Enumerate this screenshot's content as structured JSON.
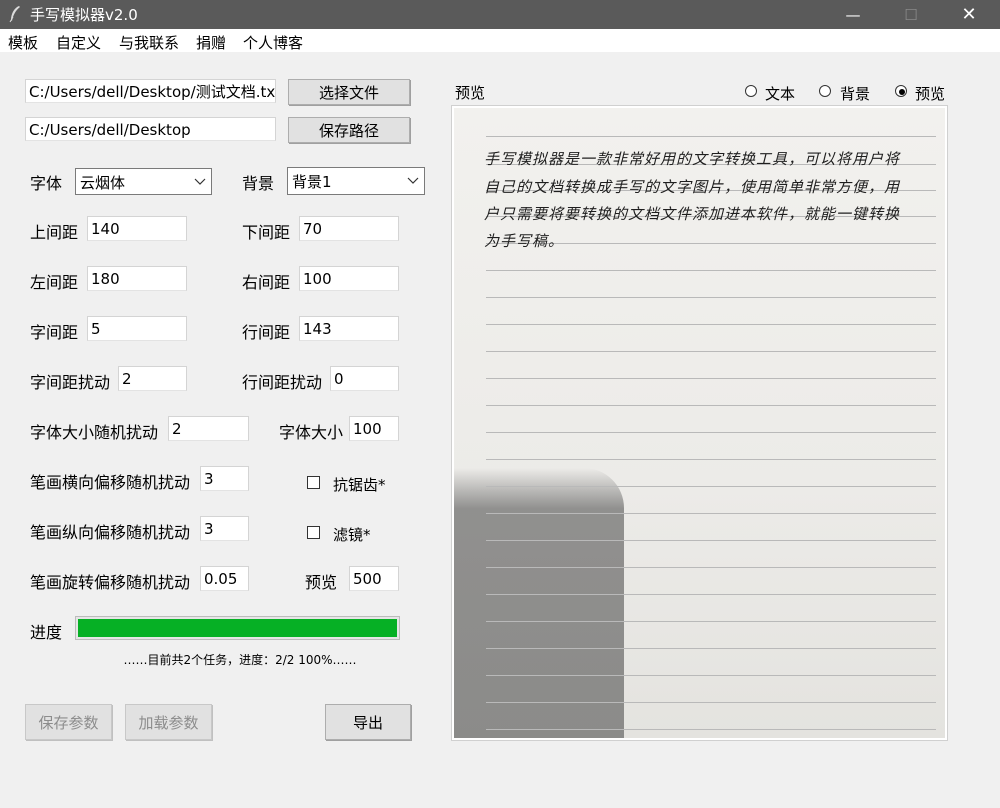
{
  "window": {
    "title": "手写模拟器v2.0",
    "controls": {
      "minimize": "—",
      "maximize": "☐",
      "close": "✕"
    }
  },
  "menu": [
    "模板",
    "自定义",
    "与我联系",
    "捐赠",
    "个人博客"
  ],
  "files": {
    "input_path": "C:/Users/dell/Desktop/测试文档.txt",
    "select_file_label": "选择文件",
    "output_path": "C:/Users/dell/Desktop",
    "save_path_label": "保存路径"
  },
  "font": {
    "label": "字体",
    "value": "云烟体"
  },
  "background": {
    "label": "背景",
    "value": "背景1"
  },
  "params": {
    "top_margin": {
      "label": "上间距",
      "value": "140"
    },
    "bottom_margin": {
      "label": "下间距",
      "value": "70"
    },
    "left_margin": {
      "label": "左间距",
      "value": "180"
    },
    "right_margin": {
      "label": "右间距",
      "value": "100"
    },
    "char_spacing": {
      "label": "字间距",
      "value": "5"
    },
    "line_spacing": {
      "label": "行间距",
      "value": "143"
    },
    "char_spacing_jitter": {
      "label": "字间距扰动",
      "value": "2"
    },
    "line_spacing_jitter": {
      "label": "行间距扰动",
      "value": "0"
    },
    "font_size_jitter": {
      "label": "字体大小随机扰动",
      "value": "2"
    },
    "font_size": {
      "label": "字体大小",
      "value": "100"
    },
    "stroke_h_jitter": {
      "label": "笔画横向偏移随机扰动",
      "value": "3"
    },
    "stroke_v_jitter": {
      "label": "笔画纵向偏移随机扰动",
      "value": "3"
    },
    "stroke_rot_jitter": {
      "label": "笔画旋转偏移随机扰动",
      "value": "0.05"
    },
    "preview": {
      "label": "预览",
      "value": "500"
    }
  },
  "options": {
    "antialias": {
      "label": "抗锯齿*",
      "checked": false
    },
    "filter": {
      "label": "滤镜*",
      "checked": false
    }
  },
  "progress": {
    "label": "进度",
    "value": 1.0,
    "status": "……目前共2个任务，进度：2/2  100%……",
    "color": "#06b025"
  },
  "actions": {
    "save_params": "保存参数",
    "load_params": "加载参数",
    "export": "导出"
  },
  "preview_panel": {
    "label": "预览",
    "modes": [
      {
        "label": "文本",
        "selected": false
      },
      {
        "label": "背景",
        "selected": false
      },
      {
        "label": "预览",
        "selected": true
      }
    ],
    "handwriting": [
      "手写模拟器是一款非常好用的文字转换工具，可以将用户将",
      "自己的文档转换成手写的文字图片，使用简单非常方便，用",
      "户只需要将要转换的文档文件添加进本软件，就能一键转换",
      "为手写稿。"
    ]
  }
}
